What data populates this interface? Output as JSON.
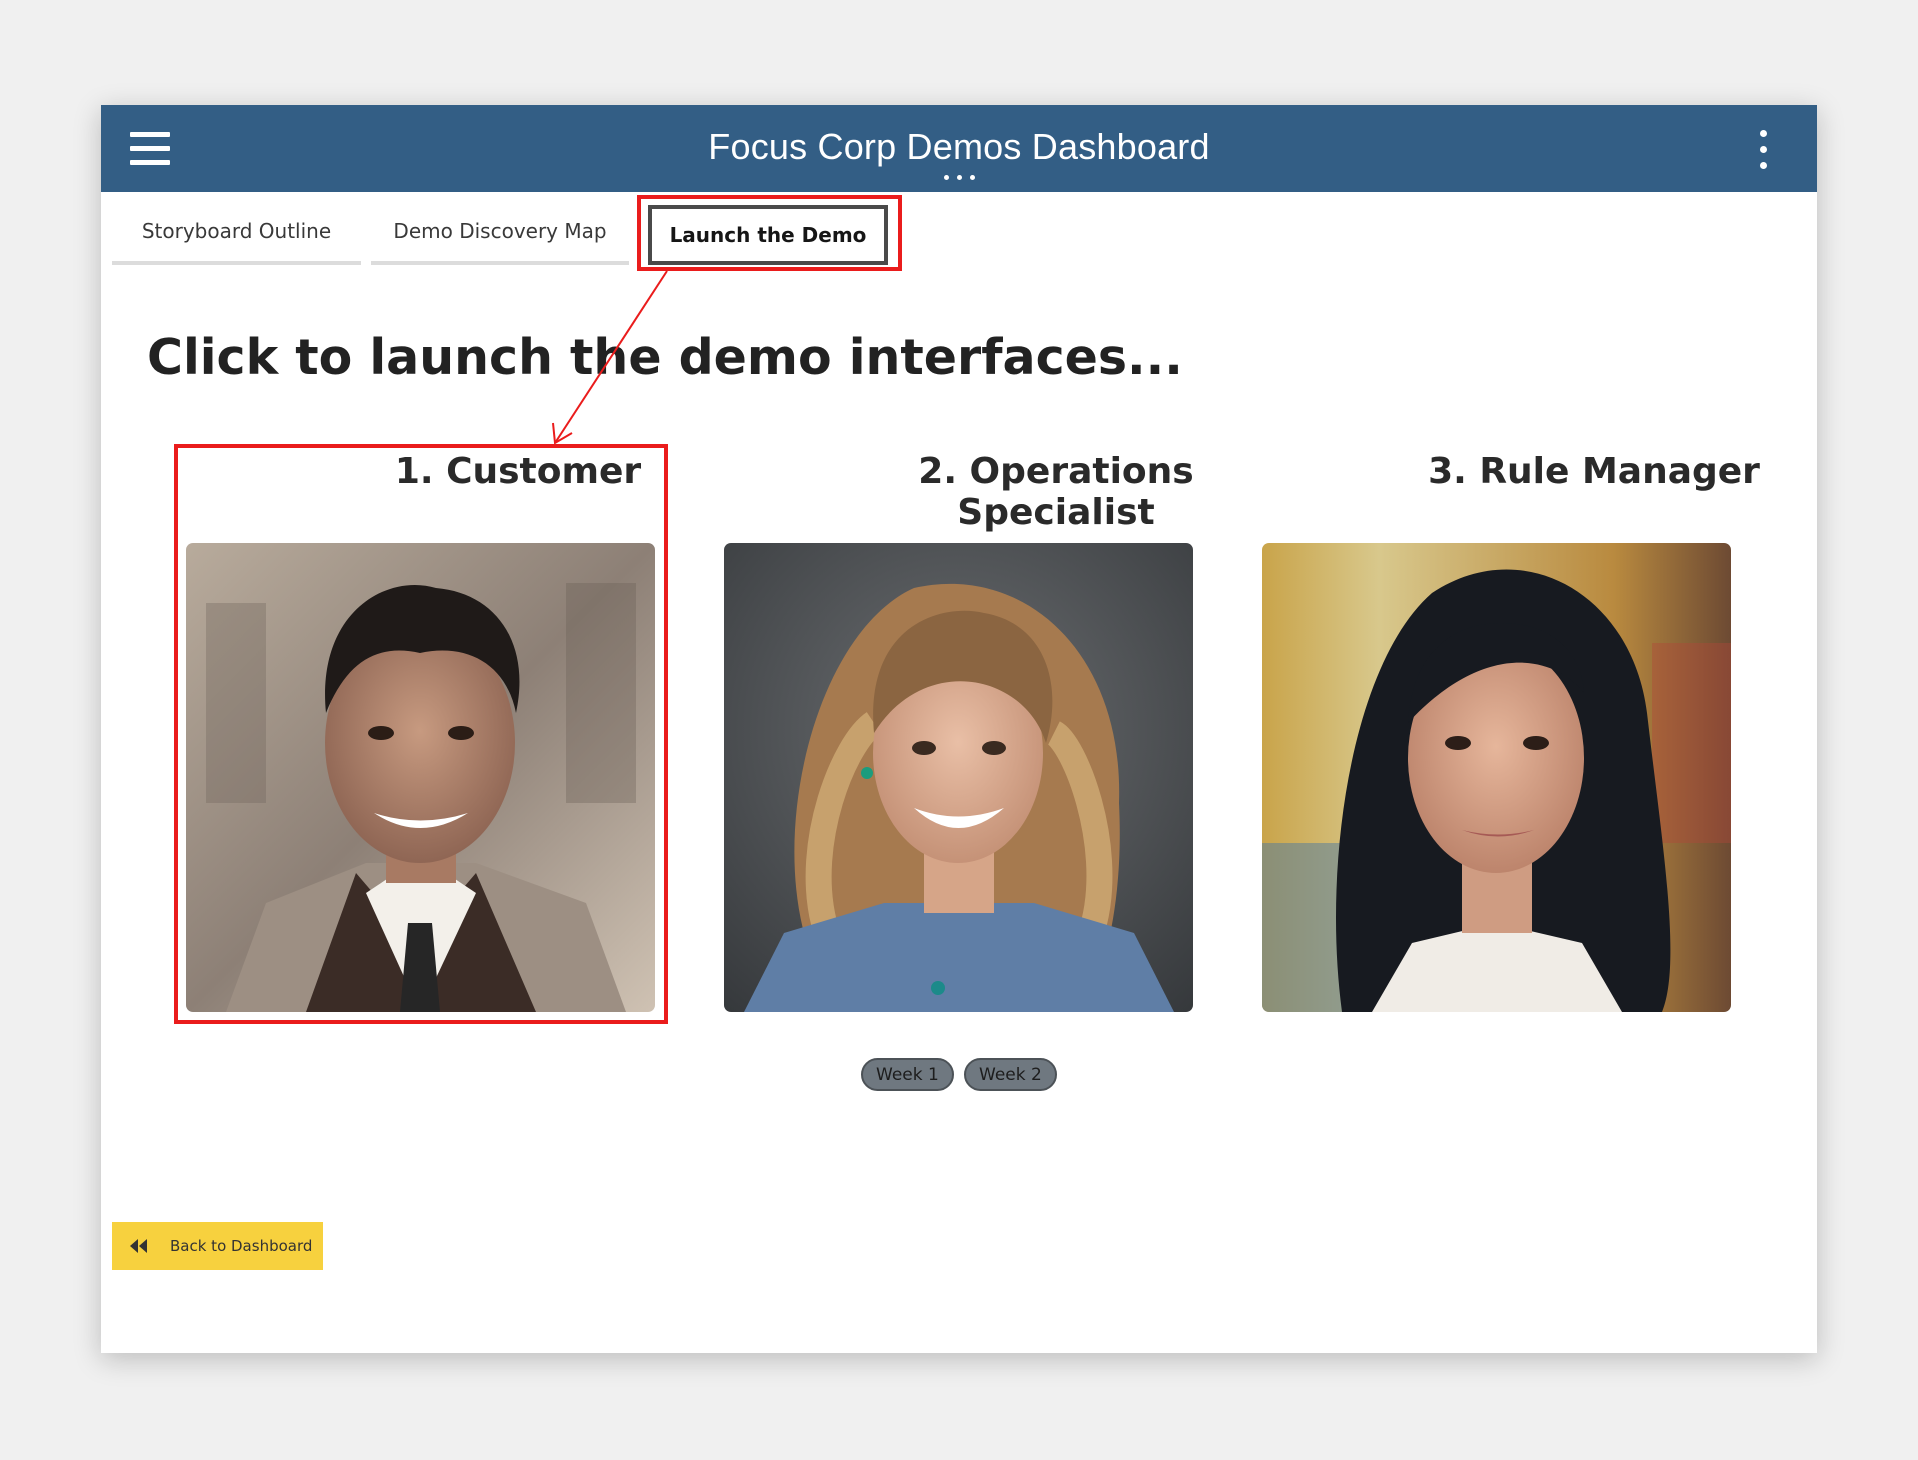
{
  "header": {
    "title": "Focus Corp Demos Dashboard",
    "menu_icon": "hamburger-menu-icon",
    "overflow_icon": "vertical-ellipsis-icon",
    "background_color": "#335e85"
  },
  "tabs": [
    {
      "label": "Storyboard Outline",
      "active": false
    },
    {
      "label": "Demo Discovery Map",
      "active": false
    },
    {
      "label": "Launch the Demo",
      "active": true
    }
  ],
  "main": {
    "headline": "Click to launch the demo interfaces...",
    "personas": [
      {
        "title": "1. Customer",
        "image": "portrait-man-smiling"
      },
      {
        "title": "2. Operations Specialist",
        "image": "portrait-woman-wavy-hair"
      },
      {
        "title": "3. Rule Manager",
        "image": "portrait-woman-dark-hair"
      }
    ],
    "week_chips": [
      "Week 1",
      "Week 2"
    ]
  },
  "footer": {
    "back_button_label": "Back to Dashboard",
    "back_button_icon": "rewind-icon",
    "back_button_color": "#f7d13e"
  },
  "annotation": {
    "highlight_color": "#ea1c1c"
  }
}
